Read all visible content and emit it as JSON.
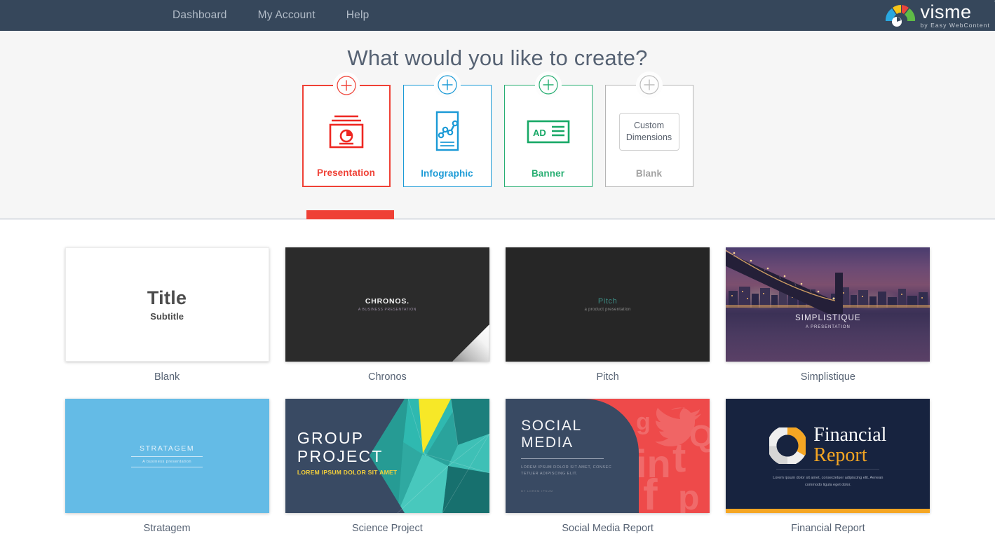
{
  "nav": {
    "links": [
      {
        "label": "Dashboard",
        "name": "nav-link-dashboard"
      },
      {
        "label": "My Account",
        "name": "nav-link-my-account"
      },
      {
        "label": "Help",
        "name": "nav-link-help"
      }
    ],
    "logo": {
      "wordmark": "visme",
      "tm": "™",
      "tagline": "by Easy WebContent"
    }
  },
  "chooser": {
    "headline": "What would you like to create?",
    "active_type": "Presentation",
    "types": [
      {
        "label": "Presentation",
        "color": "#ef4136",
        "icon": "presentation-icon",
        "active": true
      },
      {
        "label": "Infographic",
        "color": "#1b9ad6",
        "icon": "infographic-icon",
        "active": false
      },
      {
        "label": "Banner",
        "color": "#27ae72",
        "icon": "banner-ad-icon",
        "active": false
      },
      {
        "label": "Blank",
        "color": "#a2a2a2",
        "icon": "custom-dimensions-button",
        "active": false
      }
    ],
    "custom_dimensions_label": "Custom\nDimensions",
    "custom_dimensions_line1": "Custom",
    "custom_dimensions_line2": "Dimensions"
  },
  "gallery": {
    "templates": [
      {
        "name": "Blank",
        "thumb_title": "Title",
        "thumb_subtitle": "Subtitle"
      },
      {
        "name": "Chronos",
        "thumb_title": "CHRONOS.",
        "thumb_subtitle": "A BUSINESS PRESENTATION"
      },
      {
        "name": "Pitch",
        "thumb_title": "Pitch",
        "thumb_subtitle": "a product presentation"
      },
      {
        "name": "Simplistique",
        "thumb_title": "SIMPLISTIQUE",
        "thumb_subtitle": "A PRESENTATION"
      },
      {
        "name": "Stratagem",
        "thumb_title": "STRATAGEM",
        "thumb_subtitle": "A business presentation"
      },
      {
        "name": "Science Project",
        "thumb_title_line1": "GROUP",
        "thumb_title_line2": "PROJECT",
        "thumb_subtitle": "LOREM IPSUM DOLOR SIT AMET"
      },
      {
        "name": "Social Media Report",
        "thumb_title_line1": "SOCIAL",
        "thumb_title_line2": "MEDIA",
        "thumb_body": "LOREM IPSUM DOLOR SIT AMET, CONSEC TETUER ADIPISCING ELIT.",
        "thumb_byline": "BY LOREM IPSUM"
      },
      {
        "name": "Financial Report",
        "thumb_title_line1": "Financial",
        "thumb_title_line2": "Report",
        "thumb_body": "Lorem ipsum dolor sit amet, consectetuer adipiscing elit. Aenean commodo ligula eget dolor."
      }
    ]
  },
  "colors": {
    "nav_bg": "#36475b",
    "accent_red": "#ef4136",
    "accent_blue": "#1b9ad6",
    "accent_green": "#27ae72",
    "accent_gray": "#a2a2a2",
    "panel_bg": "#f6f6f6"
  }
}
